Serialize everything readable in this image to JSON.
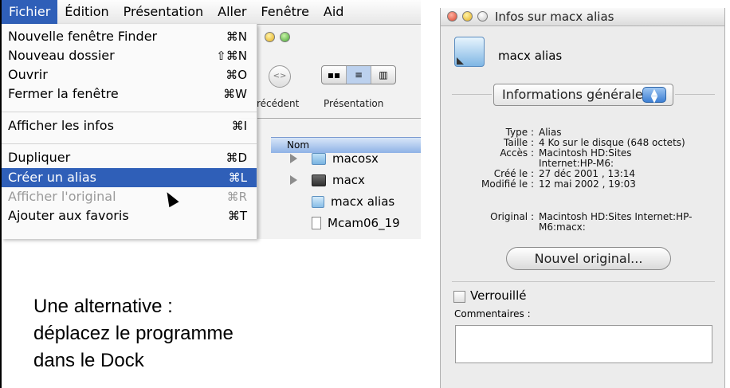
{
  "menubar": {
    "items": [
      "Fichier",
      "Édition",
      "Présentation",
      "Aller",
      "Fenêtre",
      "Aid"
    ],
    "active_index": 0
  },
  "fichier_menu": {
    "items": [
      {
        "label": "Nouvelle fenêtre Finder",
        "shortcut": "⌘N",
        "state": "normal"
      },
      {
        "label": "Nouveau dossier",
        "shortcut": "⇧⌘N",
        "state": "normal"
      },
      {
        "label": "Ouvrir",
        "shortcut": "⌘O",
        "state": "normal"
      },
      {
        "label": "Fermer la fenêtre",
        "shortcut": "⌘W",
        "state": "normal"
      },
      {
        "label": "Afficher les infos",
        "shortcut": "⌘I",
        "state": "normal"
      },
      {
        "label": "Dupliquer",
        "shortcut": "⌘D",
        "state": "normal"
      },
      {
        "label": "Créer un alias",
        "shortcut": "⌘L",
        "state": "highlighted"
      },
      {
        "label": "Afficher l'original",
        "shortcut": "⌘R",
        "state": "disabled"
      },
      {
        "label": "Ajouter aux favoris",
        "shortcut": "⌘T",
        "state": "normal"
      }
    ]
  },
  "finder_window": {
    "toolbar_labels": [
      "récédent",
      "Présentation"
    ],
    "column_header": "Nom",
    "files": [
      {
        "name": "macosx",
        "icon": "folder-icon"
      },
      {
        "name": "macx",
        "icon": "dark-folder-icon"
      },
      {
        "name": "macx alias",
        "icon": "alias-icon"
      },
      {
        "name": "Mcam06_19",
        "icon": "document-icon"
      }
    ]
  },
  "caption": {
    "lines": [
      "Une alternative :",
      "déplacez le programme",
      "dans le Dock"
    ]
  },
  "info_window": {
    "title": "Infos sur macx alias",
    "item_name": "macx alias",
    "popup_value": "Informations générales",
    "fields": [
      {
        "key": "Type :",
        "value": "Alias"
      },
      {
        "key": "Taille :",
        "value": "4 Ko sur le disque (648 octets)"
      },
      {
        "key": "Accès :",
        "value": "Macintosh HD:Sites"
      },
      {
        "key": "",
        "value": "Internet:HP-M6:"
      },
      {
        "key": "Créé le :",
        "value": "27 déc 2001 , 13:14"
      },
      {
        "key": "Modifié le :",
        "value": "12 mai 2002 , 19:03"
      }
    ],
    "original_key": "Original :",
    "original_value_lines": [
      "Macintosh HD:Sites Internet:HP-",
      "M6:macx:"
    ],
    "new_original_button": "Nouvel original...",
    "locked_label": "Verrouillé",
    "comments_label": "Commentaires :",
    "comments_value": ""
  }
}
